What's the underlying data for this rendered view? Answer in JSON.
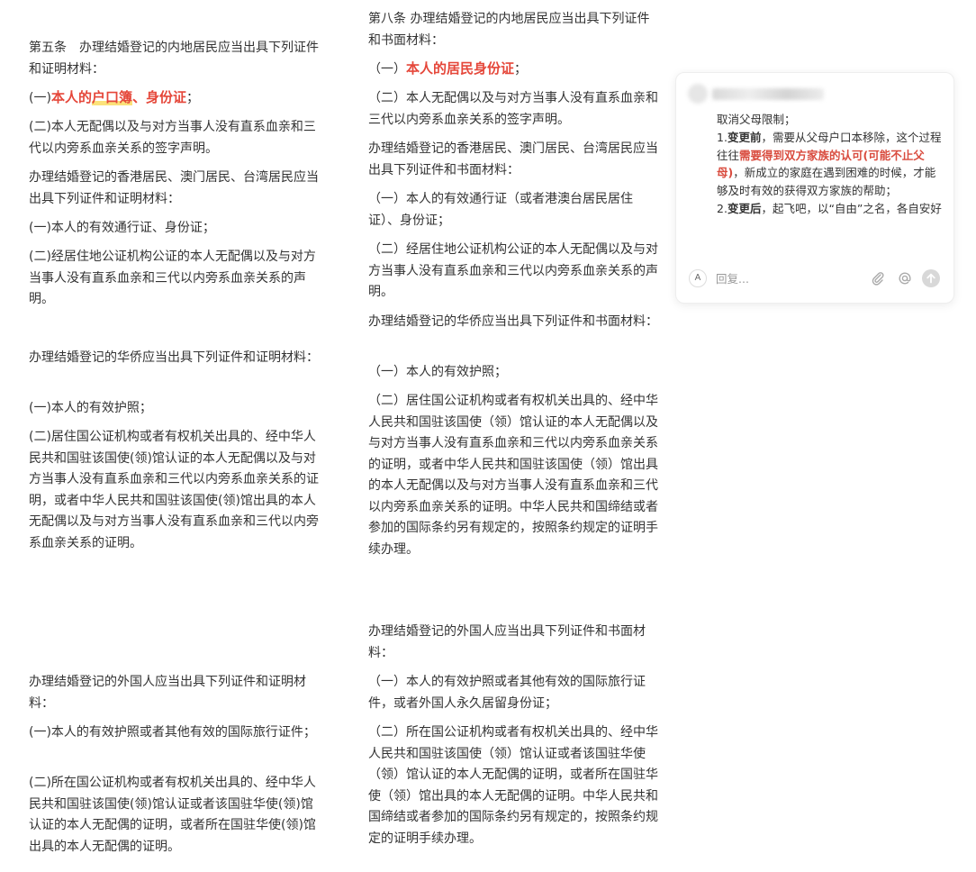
{
  "left_column": {
    "p1": "第五条　办理结婚登记的内地居民应当出具下列证件和证明材料：",
    "p2_prefix": "(一)",
    "p2_red_1": "本人的",
    "p2_red_hl": "户口簿",
    "p2_red_2": "、身份证",
    "p2_suffix": "；",
    "p3": "(二)本人无配偶以及与对方当事人没有直系血亲和三代以内旁系血亲关系的签字声明。",
    "p4": "办理结婚登记的香港居民、澳门居民、台湾居民应当出具下列证件和证明材料：",
    "p5": "(一)本人的有效通行证、身份证；",
    "p6": "(二)经居住地公证机构公证的本人无配偶以及与对方当事人没有直系血亲和三代以内旁系血亲关系的声明。",
    "p7": "办理结婚登记的华侨应当出具下列证件和证明材料：",
    "p8": "(一)本人的有效护照；",
    "p9": "(二)居住国公证机构或者有权机关出具的、经中华人民共和国驻该国使(领)馆认证的本人无配偶以及与对方当事人没有直系血亲和三代以内旁系血亲关系的证明，或者中华人民共和国驻该国使(领)馆出具的本人无配偶以及与对方当事人没有直系血亲和三代以内旁系血亲关系的证明。",
    "p10": "办理结婚登记的外国人应当出具下列证件和证明材料：",
    "p11": "(一)本人的有效护照或者其他有效的国际旅行证件；",
    "p12": "(二)所在国公证机构或者有权机关出具的、经中华人民共和国驻该国使(领)馆认证或者该国驻华使(领)馆认证的本人无配偶的证明，或者所在国驻华使(领)馆出具的本人无配偶的证明。"
  },
  "middle_column": {
    "p1": "第八条 办理结婚登记的内地居民应当出具下列证件和书面材料：",
    "p2_prefix": "（一）",
    "p2_red": "本人的居民身份证",
    "p2_suffix": "；",
    "p3": "（二）本人无配偶以及与对方当事人没有直系血亲和三代以内旁系血亲关系的签字声明。",
    "p4": "办理结婚登记的香港居民、澳门居民、台湾居民应当出具下列证件和书面材料：",
    "p5": "（一）本人的有效通行证（或者港澳台居民居住证）、身份证；",
    "p6": "（二）经居住地公证机构公证的本人无配偶以及与对方当事人没有直系血亲和三代以内旁系血亲关系的声明。",
    "p7": "办理结婚登记的华侨应当出具下列证件和书面材料：",
    "p8": "（一）本人的有效护照；",
    "p9": "（二）居住国公证机构或者有权机关出具的、经中华人民共和国驻该国使（领）馆认证的本人无配偶以及与对方当事人没有直系血亲和三代以内旁系血亲关系的证明，或者中华人民共和国驻该国使（领）馆出具的本人无配偶以及与对方当事人没有直系血亲和三代以内旁系血亲关系的证明。中华人民共和国缔结或者参加的国际条约另有规定的，按照条约规定的证明手续办理。",
    "p10": "办理结婚登记的外国人应当出具下列证件和书面材料：",
    "p11": "（一）本人的有效护照或者其他有效的国际旅行证件，或者外国人永久居留身份证；",
    "p12": "（二）所在国公证机构或者有权机关出具的、经中华人民共和国驻该国使（领）馆认证或者该国驻华使（领）馆认证的本人无配偶的证明，或者所在国驻华使（领）馆出具的本人无配偶的证明。中华人民共和国缔结或者参加的国际条约另有规定的，按照条约规定的证明手续办理。"
  },
  "comment": {
    "line1": "取消父母限制；",
    "item1_num": "1.",
    "item1_bold": "变更前",
    "item1_text_a": "，需要从父母户口本移除，这个过程往往",
    "item1_red": "需要得到双方家族的认可(可能不止父母)",
    "item1_text_b": "，新成立的家庭在遇到困难的时候，才能够及时有效的获得双方家族的帮助；",
    "item2_num": "2.",
    "item2_bold": "变更后",
    "item2_text": "，起飞吧，以“自由”之名，各自安好",
    "reply_avatar_letter": "A",
    "reply_placeholder": "回复..."
  },
  "colors": {
    "text": "#333333",
    "red": "#e5473a",
    "highlight": "#fbe27a"
  },
  "icons": [
    "paperclip-icon",
    "at-sign-icon",
    "send-arrow-icon"
  ]
}
